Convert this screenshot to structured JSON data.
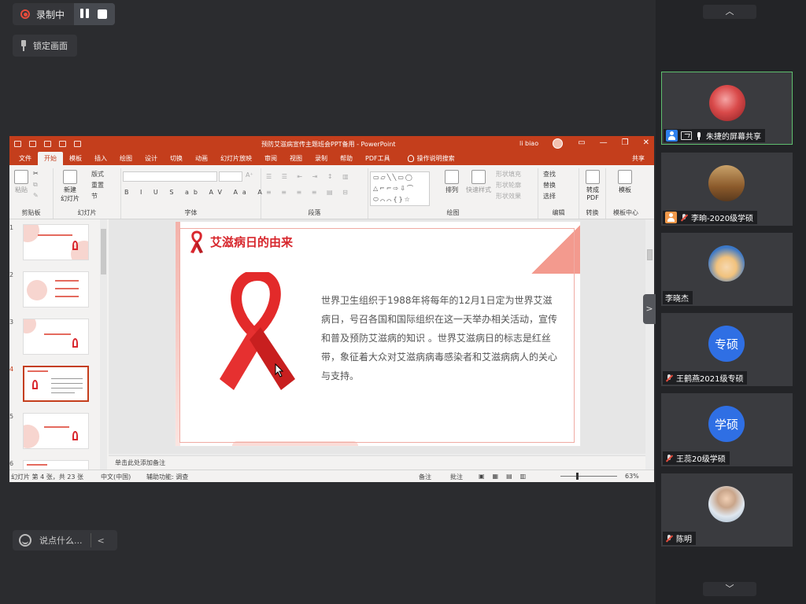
{
  "recording": {
    "status": "录制中",
    "lock_label": "锁定画面"
  },
  "ppt": {
    "title": "预防艾滋病宣传主题班会PPT备用  -  PowerPoint",
    "user": "li biao",
    "share": "共享",
    "tabs": [
      "文件",
      "开始",
      "模板",
      "插入",
      "绘图",
      "设计",
      "切换",
      "动画",
      "幻灯片放映",
      "审阅",
      "视图",
      "录制",
      "帮助",
      "PDF工具"
    ],
    "tell_me": "操作说明搜索",
    "groups": {
      "clipboard": "剪贴板",
      "slides": "幻灯片",
      "font": "字体",
      "paragraph": "段落",
      "drawing": "绘图",
      "editing": "编辑",
      "convert": "转换",
      "template_center": "模板中心"
    },
    "ribbon": {
      "paste": "粘贴",
      "new_slide_1": "新建",
      "new_slide_2": "幻灯片",
      "layout": "版式",
      "reset": "重置",
      "section": "节",
      "arrange": "排列",
      "quick_styles": "快速样式",
      "shape_fill": "形状填充",
      "shape_outline": "形状轮廓",
      "shape_effects": "形状效果",
      "find": "查找",
      "replace": "替换",
      "select": "选择",
      "to_pdf_1": "转成",
      "to_pdf_2": "PDF",
      "template": "模板"
    },
    "slide": {
      "title": "艾滋病日的由来",
      "body": "世界卫生组织于1988年将每年的12月1日定为世界艾滋病日，号召各国和国际组织在这一天举办相关活动，宣传和普及预防艾滋病的知识 。世界艾滋病日的标志是红丝带，象征着大众对艾滋病病毒感染者和艾滋病病人的关心与支持。"
    },
    "thumb_numbers": [
      "1",
      "2",
      "3",
      "4",
      "5",
      "6"
    ],
    "notes_placeholder": "单击此处添加备注",
    "status": {
      "slide_count": "幻灯片 第 4 张，共 23 张",
      "language": "中文(中国)",
      "accessibility": "辅助功能: 调查",
      "notes": "备注",
      "comments": "批注",
      "zoom": "63%"
    }
  },
  "chat": {
    "placeholder": "说点什么..."
  },
  "participants": [
    {
      "name": "朱捷的屏幕共享",
      "avatar": "rose",
      "mic": "on",
      "active": true
    },
    {
      "name": "李晌-2020级学硕",
      "avatar": "photo",
      "mic": "off",
      "active": false
    },
    {
      "name": "李晓杰",
      "avatar": "cartoon",
      "mic": "none",
      "active": false
    },
    {
      "name": "王鹤燕2021级专硕",
      "avatar": "专硕",
      "mic": "off",
      "active": false
    },
    {
      "name": "王蕊20级学硕",
      "avatar": "学硕",
      "mic": "off",
      "active": false
    },
    {
      "name": "陈明",
      "avatar": "guitar",
      "mic": "off",
      "active": false
    }
  ],
  "colors": {
    "ppt_red": "#c43e1c",
    "ribbon_red": "#d9272e",
    "avatar_blue": "#2f6fe4"
  }
}
